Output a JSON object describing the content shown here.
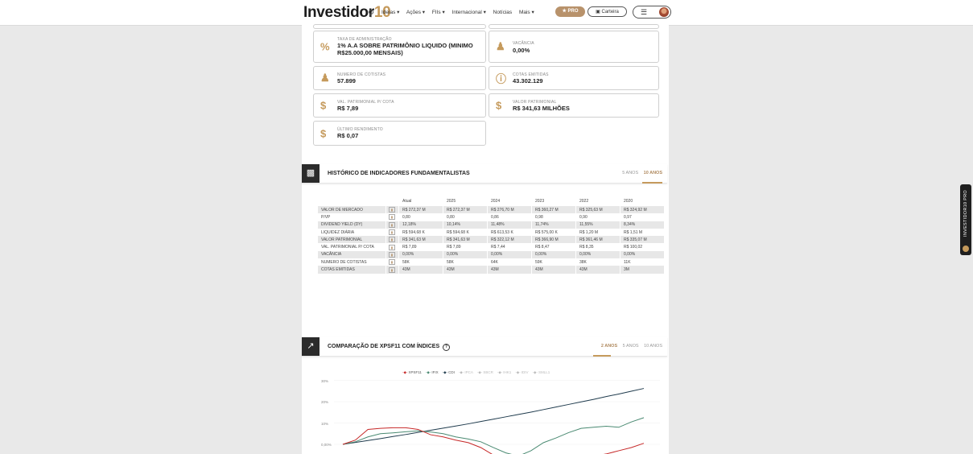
{
  "header": {
    "logo_text": "Investidor",
    "logo_number": "10",
    "nav": [
      "Ideias ▾",
      "Ações ▾",
      "FIIs ▾",
      "Internacional ▾",
      "Notícias",
      "Mais ▾"
    ],
    "pro_label": "★ PRO",
    "carteira_label": "▣ Carteira",
    "menu_icon": "☰"
  },
  "info_cards": [
    {
      "icon": "percent-icon",
      "label": "TAXA DE ADMINISTRAÇÃO",
      "value": "1% A.A SOBRE PATRIMÔNIO LIQUIDO (MINIMO R$25.000,00 MENSAIS)"
    },
    {
      "icon": "people-icon",
      "label": "VACÂNCIA",
      "value": "0,00%"
    },
    {
      "icon": "people-icon",
      "label": "NUMERO DE COTISTAS",
      "value": "57.899"
    },
    {
      "icon": "question-icon",
      "label": "COTAS EMITIDAS",
      "value": "43.302.129"
    },
    {
      "icon": "dollar-icon",
      "label": "VAL. PATRIMONIAL P/ COTA",
      "value": "R$ 7,89"
    },
    {
      "icon": "dollar-icon",
      "label": "VALOR PATRIMONIAL",
      "value": "R$ 341,63 MILHÕES"
    },
    {
      "icon": "dollar-icon",
      "label": "ÚLTIMO RENDIMENTO",
      "value": "R$ 0,07"
    }
  ],
  "historico": {
    "title": "HISTÓRICO DE INDICADORES FUNDAMENTALISTAS",
    "tabs": [
      "5 ANOS",
      "10 ANOS"
    ],
    "active_tab": "10 ANOS",
    "columns": [
      "Atual",
      "2025",
      "2024",
      "2023",
      "2022",
      "2020"
    ],
    "rows": [
      {
        "name": "VALOR DE MERCADO",
        "values": [
          "R$ 272,37 M",
          "R$ 272,37 M",
          "R$ 276,70 M",
          "R$ 360,27 M",
          "R$ 325,63 M",
          "R$ 324,92 M"
        ]
      },
      {
        "name": "P/VP",
        "values": [
          "0,80",
          "0,80",
          "0,86",
          "0,98",
          "0,90",
          "0,97"
        ]
      },
      {
        "name": "DIVIDEND YIELD (DY)",
        "values": [
          "12,18%",
          "10,14%",
          "11,48%",
          "11,74%",
          "11,55%",
          "8,34%"
        ]
      },
      {
        "name": "LIQUIDEZ DIÁRIA",
        "values": [
          "R$ 594,68 K",
          "R$ 594,68 K",
          "R$ 613,53 K",
          "R$ 575,00 K",
          "R$ 1,20 M",
          "R$ 1,51 M"
        ]
      },
      {
        "name": "VALOR PATRIMONIAL",
        "values": [
          "R$ 341,63 M",
          "R$ 341,63 M",
          "R$ 322,12 M",
          "R$ 366,90 M",
          "R$ 361,46 M",
          "R$ 335,07 M"
        ]
      },
      {
        "name": "VAL. PATRIMONIAL P/ COTA",
        "values": [
          "R$ 7,89",
          "R$ 7,89",
          "R$ 7,44",
          "R$ 8,47",
          "R$ 8,35",
          "R$ 100,02"
        ]
      },
      {
        "name": "VACÂNCIA",
        "values": [
          "0,00%",
          "0,00%",
          "0,00%",
          "0,00%",
          "0,00%",
          "0,00%"
        ]
      },
      {
        "name": "NUMERO DE COTISTAS",
        "values": [
          "58K",
          "58K",
          "64K",
          "59K",
          "38K",
          "11K"
        ]
      },
      {
        "name": "COTAS EMITIDAS",
        "values": [
          "43M",
          "43M",
          "43M",
          "43M",
          "43M",
          "3M"
        ]
      }
    ]
  },
  "comparacao": {
    "title": "COMPARAÇÃO DE XPSF11 COM ÍNDICES",
    "help_icon": "?",
    "tabs": [
      "2 ANOS",
      "5 ANOS",
      "10 ANOS"
    ],
    "active_tab": "2 ANOS"
  },
  "side_badge": "INVESTIDOR10 PRO",
  "chart_data": {
    "type": "line",
    "title": "",
    "ytick_labels": [
      "30%",
      "20%",
      "10%",
      "0,00%"
    ],
    "ylim": [
      0,
      30
    ],
    "legend": [
      {
        "name": "XPSF11",
        "color": "#c62828",
        "active": true
      },
      {
        "name": "IFIX",
        "color": "#4a8a72",
        "active": true
      },
      {
        "name": "CDI",
        "color": "#1f3b4d",
        "active": true
      },
      {
        "name": "IPCA",
        "color": "#bbbbbb",
        "active": false
      },
      {
        "name": "SBCR",
        "color": "#bbbbbb",
        "active": false
      },
      {
        "name": "IHK1",
        "color": "#bbbbbb",
        "active": false
      },
      {
        "name": "IDIV",
        "color": "#bbbbbb",
        "active": false
      },
      {
        "name": "SMLL1",
        "color": "#bbbbbb",
        "active": false
      }
    ],
    "x": [
      0,
      1,
      2,
      3,
      4,
      5,
      6,
      7,
      8,
      9,
      10,
      11,
      12,
      13,
      14,
      15,
      16,
      17,
      18,
      19,
      20,
      21,
      22,
      23,
      24
    ],
    "series": [
      {
        "name": "CDI",
        "values": [
          0,
          0.9,
          1.8,
          2.7,
          3.7,
          4.6,
          5.6,
          6.6,
          7.6,
          8.6,
          9.6,
          10.7,
          11.8,
          12.9,
          14.0,
          15.1,
          16.3,
          17.5,
          18.7,
          19.9,
          21.1,
          22.4,
          23.6,
          24.9,
          26.2
        ]
      },
      {
        "name": "IFIX",
        "values": [
          0,
          1.2,
          3.5,
          5.0,
          5.4,
          5.9,
          6.3,
          5.8,
          5.0,
          3.5,
          2.5,
          1.2,
          -1.5,
          -4.0,
          -5.5,
          -3.0,
          0.8,
          3.0,
          5.5,
          7.5,
          8.0,
          8.5,
          8.0,
          10.5,
          12.5
        ]
      },
      {
        "name": "XPSF11",
        "values": [
          0,
          2.0,
          7.0,
          7.5,
          7.8,
          7.8,
          7.0,
          4.5,
          3.5,
          2.0,
          0.8,
          -1.5,
          -5.0,
          -8.0,
          -9.5,
          -9.0,
          -8.5,
          -8.0,
          -7.0,
          -6.5,
          -5.5,
          -4.5,
          -3.0,
          -1.5,
          0.5
        ]
      }
    ]
  }
}
